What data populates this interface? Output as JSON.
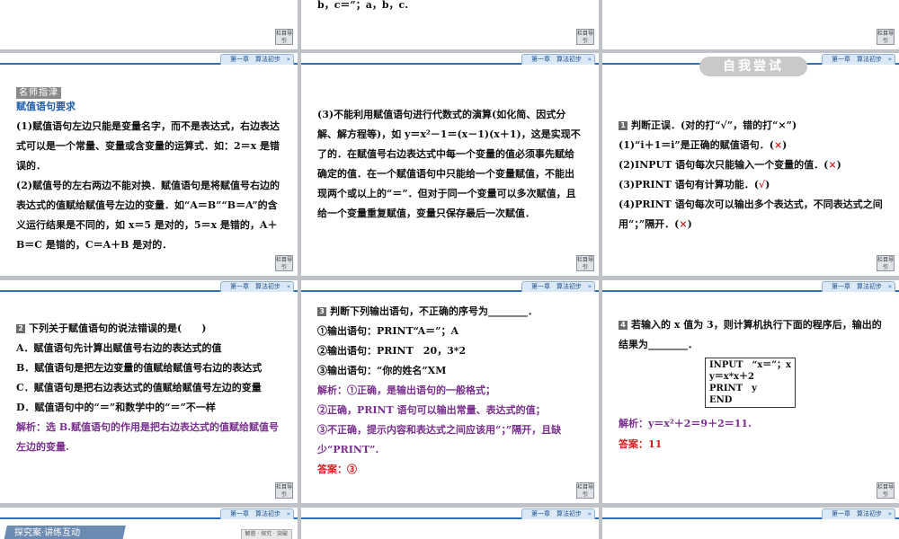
{
  "common": {
    "chapter": "第一章　算法初步",
    "nav_label": "栏目导引"
  },
  "s1": {},
  "s2": {
    "line1": "b，c＝”；a，b，c."
  },
  "s3": {},
  "s4": {
    "tag": "名师指津",
    "heading": "赋值语句要求",
    "p1": "(1)赋值语句左边只能是变量名字，而不是表达式，右边表达式可以是一个常量、变量或含变量的运算式．如：2＝x 是错误的．",
    "p2": "(2)赋值号的左右两边不能对换．赋值语句是将赋值号右边的表达式的值赋给赋值号左边的变量．如“A＝B”“B＝A”的含义运行结果是不同的，如 x＝5 是对的，5＝x 是错的，A＋B＝C 是错的，C＝A＋B 是对的．"
  },
  "s5": {
    "p3": "(3)不能利用赋值语句进行代数式的演算(如化简、因式分解、解方程等)，如 y＝x²－1＝(x－1)(x＋1)，这是实现不了的．在赋值号右边表达式中每一个变量的值必须事先赋给确定的值．在一个赋值语句中只能给一个变量赋值，不能出现两个或以上的“＝”．但对于同一个变量可以多次赋值，且给一个变量重复赋值，变量只保存最后一次赋值．"
  },
  "s6": {
    "banner": "自我尝试",
    "q1": "判断正误．(对的打“√”，错的打“×”)",
    "items": [
      {
        "text": "(1)“i＋1＝i”是正确的赋值语句．(",
        "mark": "×",
        "end": ")"
      },
      {
        "text": "(2)INPUT 语句每次只能输入一个变量的值．(",
        "mark": "×",
        "end": ")"
      },
      {
        "text": "(3)PRINT 语句有计算功能．(",
        "mark": "√",
        "end": ")"
      },
      {
        "text": "(4)PRINT 语句每次可以输出多个表达式，不同表达式之间用“；”隔开．(",
        "mark": "×",
        "end": ")"
      }
    ]
  },
  "s7": {
    "q": "下列关于赋值语句的说法错误的是(　　)",
    "opts": [
      "A．赋值语句先计算出赋值号右边的表达式的值",
      "B．赋值语句是把左边变量的值赋给赋值号右边的表达式",
      "C．赋值语句是把右边表达式的值赋给赋值号左边的变量",
      "D．赋值语句中的“＝”和数学中的“＝”不一样"
    ],
    "sol": "解析：选 B.赋值语句的作用是把右边表达式的值赋给赋值号左边的变量."
  },
  "s8": {
    "q": "判断下列输出语句，不正确的序号为________．",
    "lines": [
      "①输出语句：PRINT“A＝”；A",
      "②输出语句：PRINT　20，3*2",
      "③输出语句：“你的姓名”XM"
    ],
    "sol": [
      "解析：①正确，是输出语句的一般格式；",
      "②正确，PRINT 语句可以输出常量、表达式的值；",
      "③不正确，提示内容和表达式之间应该用“；”隔开，且缺少“PRINT”."
    ],
    "answer": "答案：③"
  },
  "s9": {
    "q": "若输入的 x 值为 3，则计算机执行下面的程序后，输出的结果为________．",
    "code": [
      "INPUT　“x＝”；x",
      "y＝x*x＋2",
      "PRINT　y",
      "END"
    ],
    "sol": "解析：y＝x²＋2＝9＋2＝11.",
    "answer": "答案：11"
  },
  "s10": {
    "tab": "探究案·讲练互动",
    "sub": "解惑 · 探究 · 突破"
  }
}
